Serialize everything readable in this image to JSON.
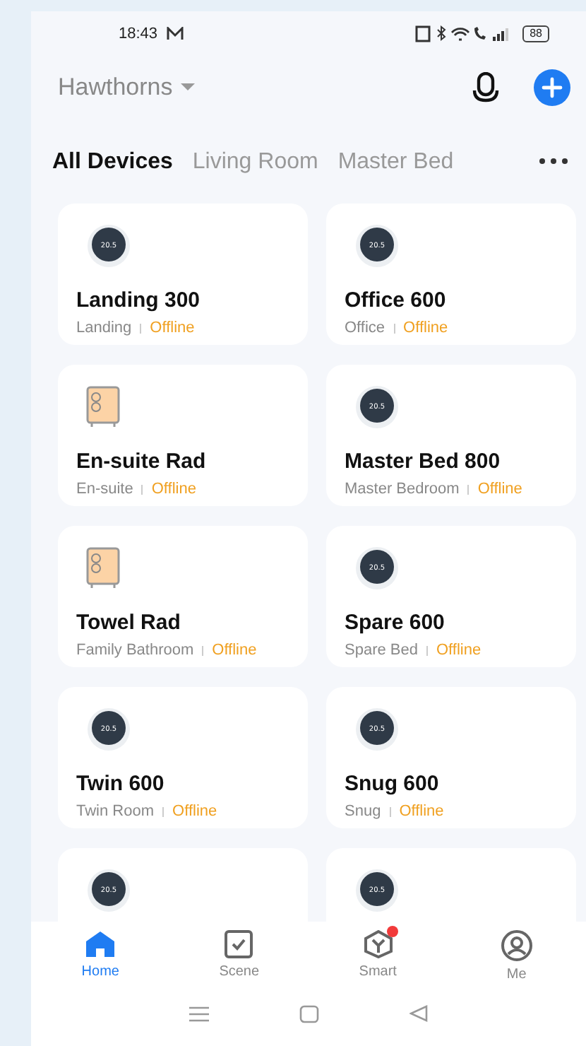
{
  "status_bar": {
    "time": "18:43",
    "battery": "88"
  },
  "header": {
    "home_name": "Hawthorns"
  },
  "tabs": [
    {
      "label": "All Devices",
      "selected": true
    },
    {
      "label": "Living Room",
      "selected": false
    },
    {
      "label": "Master Bed",
      "selected": false
    }
  ],
  "devices": [
    {
      "kind": "thermostat",
      "reading": "20.5",
      "name": "Landing 300",
      "room": "Landing",
      "status": "Offline"
    },
    {
      "kind": "thermostat",
      "reading": "20.5",
      "name": "Office 600",
      "room": "Office",
      "status": "Offline"
    },
    {
      "kind": "radiator",
      "name": "En-suite Rad",
      "room": "En-suite",
      "status": "Offline"
    },
    {
      "kind": "thermostat",
      "reading": "20.5",
      "name": "Master Bed 800",
      "room": "Master Bedroom",
      "status": "Offline"
    },
    {
      "kind": "radiator",
      "name": "Towel Rad",
      "room": "Family Bathroom",
      "status": "Offline"
    },
    {
      "kind": "thermostat",
      "reading": "20.5",
      "name": "Spare 600",
      "room": "Spare Bed",
      "status": "Offline"
    },
    {
      "kind": "thermostat",
      "reading": "20.5",
      "name": "Twin 600",
      "room": "Twin Room",
      "status": "Offline"
    },
    {
      "kind": "thermostat",
      "reading": "20.5",
      "name": "Snug 600",
      "room": "Snug",
      "status": "Offline"
    },
    {
      "kind": "thermostat",
      "reading": "20.5"
    },
    {
      "kind": "thermostat",
      "reading": "20.5"
    }
  ],
  "bottom_nav": [
    {
      "kind": "home",
      "label": "Home",
      "selected": true,
      "badge": false
    },
    {
      "kind": "scene",
      "label": "Scene",
      "selected": false,
      "badge": false
    },
    {
      "kind": "smart",
      "label": "Smart",
      "selected": false,
      "badge": true
    },
    {
      "kind": "me",
      "label": "Me",
      "selected": false,
      "badge": false
    }
  ]
}
